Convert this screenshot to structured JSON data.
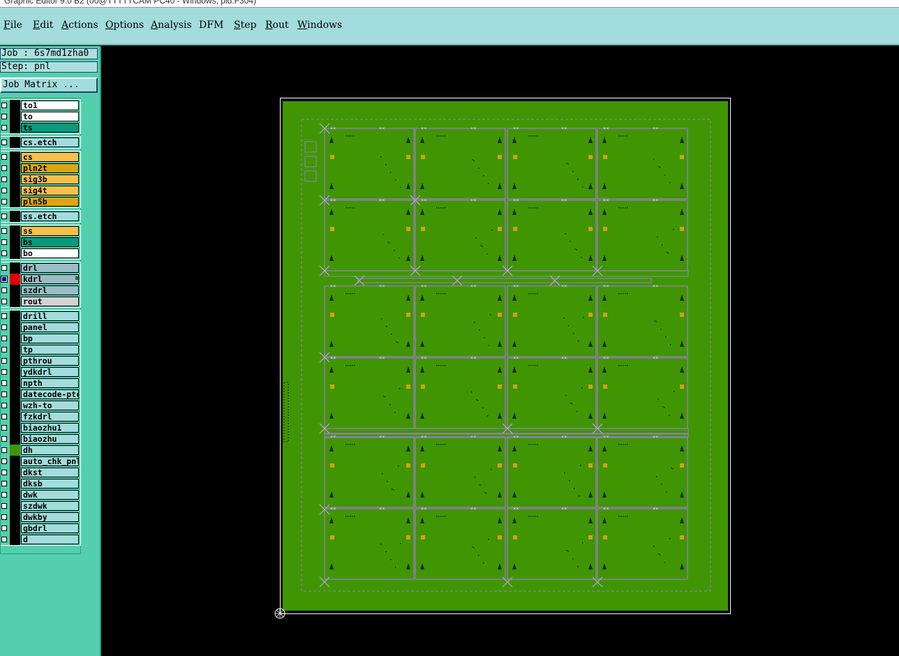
{
  "window": {
    "title": "Graphic Editor 9.0 B2 (00@TTTTTCAM PC40 - Windows, pid:F304)"
  },
  "menu": [
    {
      "label": "File",
      "accel": "F",
      "rest": "ile"
    },
    {
      "label": "Edit",
      "accel": "E",
      "rest": "dit"
    },
    {
      "label": "Actions",
      "accel": "A",
      "rest": "ctions"
    },
    {
      "label": "Options",
      "accel": "O",
      "rest": "ptions"
    },
    {
      "label": "Analysis",
      "accel": "A",
      "rest": "nalysis"
    },
    {
      "label": "DFM",
      "accel": "",
      "rest": "DFM"
    },
    {
      "label": "Step",
      "accel": "S",
      "rest": "tep"
    },
    {
      "label": "Rout",
      "accel": "R",
      "rest": "out"
    },
    {
      "label": "Windows",
      "accel": "W",
      "rest": "indows"
    }
  ],
  "sidebar": {
    "job_text": "Job : 6s7md1zha0",
    "step_text": "Step: pnl",
    "job_matrix_label": "Job Matrix ..."
  },
  "colors": {
    "board": "#3f9602",
    "outline": "#9a7ec8",
    "pad": "#d4a10c",
    "cyan_panel": "#a2dcdc",
    "teal": "#54cfae"
  },
  "layer_groups": [
    {
      "layers": [
        {
          "name": "to1",
          "bg": "#ffffff",
          "box": "#000000"
        },
        {
          "name": "to",
          "bg": "#ffffff",
          "box": "#000000"
        },
        {
          "name": "ts",
          "bg": "#0a9a7c",
          "box": "#000000"
        }
      ]
    },
    {
      "layers": [
        {
          "name": "cs.etch",
          "bg": "#a2dcdc",
          "box": "#000000"
        }
      ]
    },
    {
      "layers": [
        {
          "name": "cs",
          "bg": "#f7c04a",
          "box": "#000000"
        },
        {
          "name": "pln2t",
          "bg": "#dba612",
          "box": "#000000"
        },
        {
          "name": "sig3b",
          "bg": "#f7c04a",
          "box": "#000000"
        },
        {
          "name": "sig4t",
          "bg": "#f7c04a",
          "box": "#000000"
        },
        {
          "name": "pln5b",
          "bg": "#dba612",
          "box": "#000000"
        }
      ]
    },
    {
      "layers": [
        {
          "name": "ss.etch",
          "bg": "#a2dcdc",
          "box": "#000000"
        }
      ]
    },
    {
      "layers": [
        {
          "name": "ss",
          "bg": "#f7c04a",
          "box": "#000000"
        },
        {
          "name": "bs",
          "bg": "#0a9a7c",
          "box": "#000000"
        },
        {
          "name": "bo",
          "bg": "#ffffff",
          "box": "#000000"
        }
      ]
    },
    {
      "layers": [
        {
          "name": "drl",
          "bg": "#9bbcc6",
          "box": "#000000"
        },
        {
          "name": "kdrl",
          "bg": "#9bbcc6",
          "box": "#e00000",
          "active": true,
          "icon": "⊞"
        },
        {
          "name": "szdrl",
          "bg": "#9bbcc6",
          "box": "#000000"
        },
        {
          "name": "rout",
          "bg": "#d3d3d3",
          "box": "#000000"
        }
      ]
    },
    {
      "layers": [
        {
          "name": "drill",
          "bg": "#a2dcdc",
          "box": "#000000"
        },
        {
          "name": "panel",
          "bg": "#a2dcdc",
          "box": "#000000"
        },
        {
          "name": "bp",
          "bg": "#a2dcdc",
          "box": "#000000"
        },
        {
          "name": "tp",
          "bg": "#a2dcdc",
          "box": "#000000"
        },
        {
          "name": "pthrou",
          "bg": "#a2dcdc",
          "box": "#000000"
        },
        {
          "name": "ydkdrl",
          "bg": "#a2dcdc",
          "box": "#000000"
        },
        {
          "name": "npth",
          "bg": "#a2dcdc",
          "box": "#000000"
        },
        {
          "name": "datecode-ptc",
          "bg": "#a2dcdc",
          "box": "#000000"
        },
        {
          "name": "wzh-to",
          "bg": "#a2dcdc",
          "box": "#000000"
        },
        {
          "name": "fzkdrl",
          "bg": "#a2dcdc",
          "box": "#000000"
        },
        {
          "name": "biaozhu1",
          "bg": "#a2dcdc",
          "box": "#000000"
        },
        {
          "name": "biaozhu",
          "bg": "#a2dcdc",
          "box": "#000000"
        },
        {
          "name": "dh",
          "bg": "#a2dcdc",
          "box": "#3f9602"
        },
        {
          "name": "auto_chk_pnl",
          "bg": "#a2dcdc",
          "box": "#000000"
        },
        {
          "name": "dkst",
          "bg": "#a2dcdc",
          "box": "#000000"
        },
        {
          "name": "dksb",
          "bg": "#a2dcdc",
          "box": "#000000"
        },
        {
          "name": "dwk",
          "bg": "#a2dcdc",
          "box": "#000000"
        },
        {
          "name": "szdwk",
          "bg": "#a2dcdc",
          "box": "#000000"
        },
        {
          "name": "dwkby",
          "bg": "#a2dcdc",
          "box": "#000000"
        },
        {
          "name": "gbdrl",
          "bg": "#a2dcdc",
          "box": "#000000"
        },
        {
          "name": "d",
          "bg": "#a2dcdc",
          "box": "#000000"
        }
      ]
    }
  ],
  "panel_view": {
    "rows": 6,
    "cols": 4
  }
}
